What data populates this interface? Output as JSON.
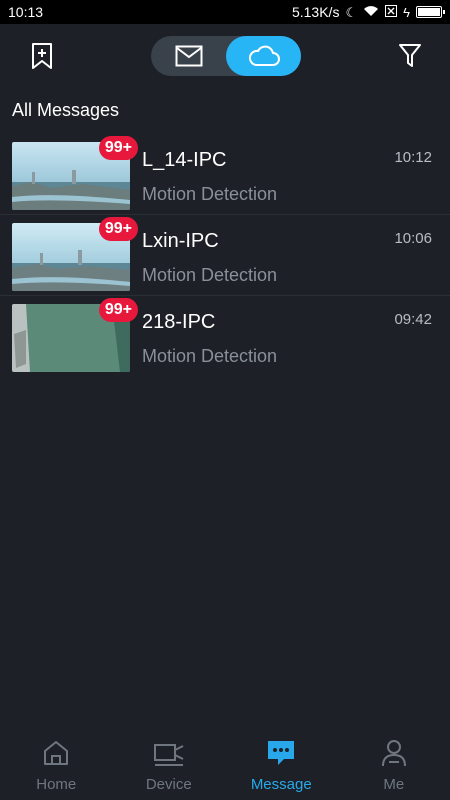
{
  "status_bar": {
    "time": "10:13",
    "speed": "5.13K/s"
  },
  "toolbar": {
    "left_icon": "bookmark-add-icon",
    "segment_items": [
      {
        "icon": "mail-icon",
        "active": false
      },
      {
        "icon": "cloud-icon",
        "active": true
      }
    ],
    "right_icon": "filter-icon",
    "accent_color": "#28b5f5"
  },
  "section_title": "All Messages",
  "messages": [
    {
      "name": "L_14-IPC",
      "type": "Motion Detection",
      "time": "10:12",
      "badge": "99+"
    },
    {
      "name": "Lxin-IPC",
      "type": "Motion Detection",
      "time": "10:06",
      "badge": "99+"
    },
    {
      "name": "218-IPC",
      "type": "Motion Detection",
      "time": "09:42",
      "badge": "99+"
    }
  ],
  "bottom_nav": [
    {
      "label": "Home",
      "icon": "home-icon",
      "active": false
    },
    {
      "label": "Device",
      "icon": "camera-icon",
      "active": false
    },
    {
      "label": "Message",
      "icon": "message-icon",
      "active": true
    },
    {
      "label": "Me",
      "icon": "person-icon",
      "active": false
    }
  ],
  "colors": {
    "badge": "#e8173c",
    "nav_active": "#28a8ea",
    "background": "#1d2127"
  }
}
